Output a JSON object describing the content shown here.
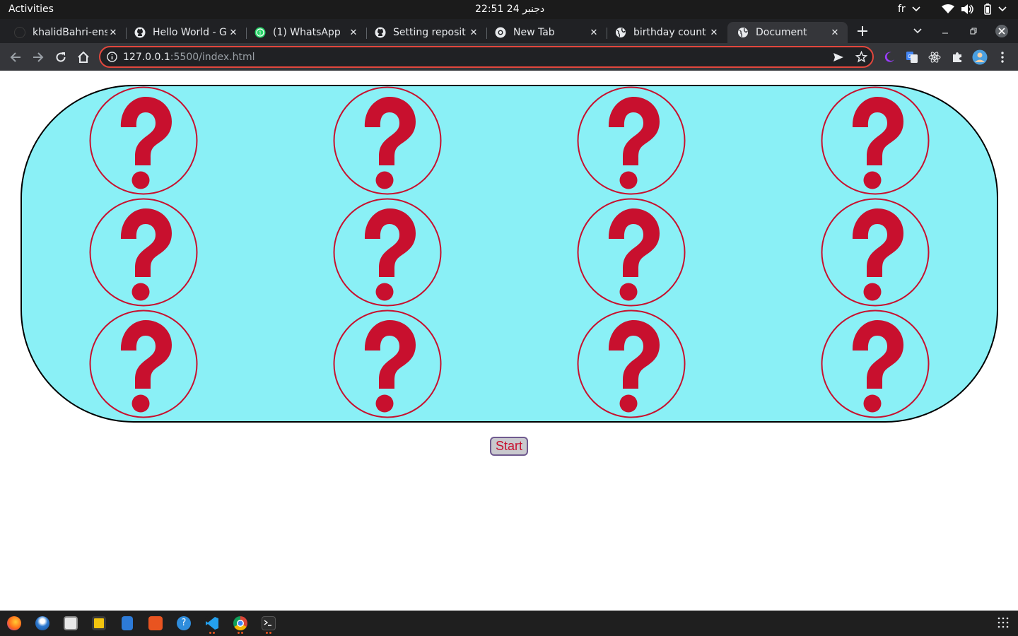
{
  "system": {
    "activities": "Activities",
    "clock": "22:51  24 دجنبر",
    "language": "fr"
  },
  "browser": {
    "tabs": [
      {
        "title": "khalidBahri-ens",
        "icon": "github-icon"
      },
      {
        "title": "Hello World - Gi",
        "icon": "github-icon"
      },
      {
        "title": "(1) WhatsApp",
        "icon": "whatsapp-icon"
      },
      {
        "title": "Setting reposit",
        "icon": "github-icon"
      },
      {
        "title": "New Tab",
        "icon": "chrome-icon"
      },
      {
        "title": "birthday count",
        "icon": "globe-icon"
      },
      {
        "title": "Document",
        "icon": "globe-icon",
        "active": true
      }
    ],
    "url_host": "127.0.0.1",
    "url_path": ":5500/index.html"
  },
  "page": {
    "card_rows": 3,
    "card_cols": 4,
    "card_symbol": "question-mark",
    "start_label": "Start",
    "colors": {
      "board": "#8af0f6",
      "question": "#c8102e"
    }
  },
  "taskbar": {
    "apps": [
      "firefox-icon",
      "thunderbird-icon",
      "files-icon",
      "rhythmbox-icon",
      "writer-icon",
      "software-icon",
      "help-icon",
      "vscode-icon",
      "chrome-icon",
      "terminal-icon"
    ]
  }
}
